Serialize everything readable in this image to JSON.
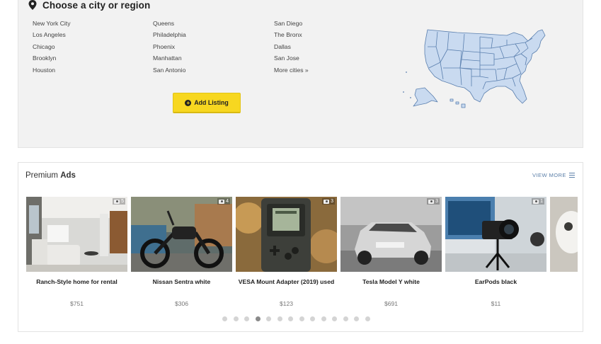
{
  "region": {
    "title": "Choose a city or region",
    "columns": [
      [
        "New York City",
        "Los Angeles",
        "Chicago",
        "Brooklyn",
        "Houston"
      ],
      [
        "Queens",
        "Philadelphia",
        "Phoenix",
        "Manhattan",
        "San Antonio"
      ],
      [
        "San Diego",
        "The Bronx",
        "Dallas",
        "San Jose",
        "More cities »"
      ]
    ],
    "add_listing_label": "Add Listing"
  },
  "premium": {
    "title_light": "Premium ",
    "title_bold": "Ads",
    "view_more": "VIEW MORE",
    "ads": [
      {
        "title": "Ranch-Style home for rental",
        "price": "$751",
        "photos": "5",
        "image": "living-room-photo"
      },
      {
        "title": "Nissan Sentra white",
        "price": "$306",
        "photos": "4",
        "image": "motorcycle-photo"
      },
      {
        "title": "VESA Mount Adapter (2019) used",
        "price": "$123",
        "photos": "3",
        "image": "gameboy-photo"
      },
      {
        "title": "Tesla Model Y white",
        "price": "$691",
        "photos": "3",
        "image": "car-photo"
      },
      {
        "title": "EarPods black",
        "price": "$11",
        "photos": "1",
        "image": "camera-photo"
      }
    ],
    "pager": {
      "total": 14,
      "active_index": 3
    }
  },
  "colors": {
    "accent_button": "#f7d720",
    "link": "#5b7fa8",
    "map_fill": "#c9daf0",
    "map_stroke": "#5a7fae"
  }
}
